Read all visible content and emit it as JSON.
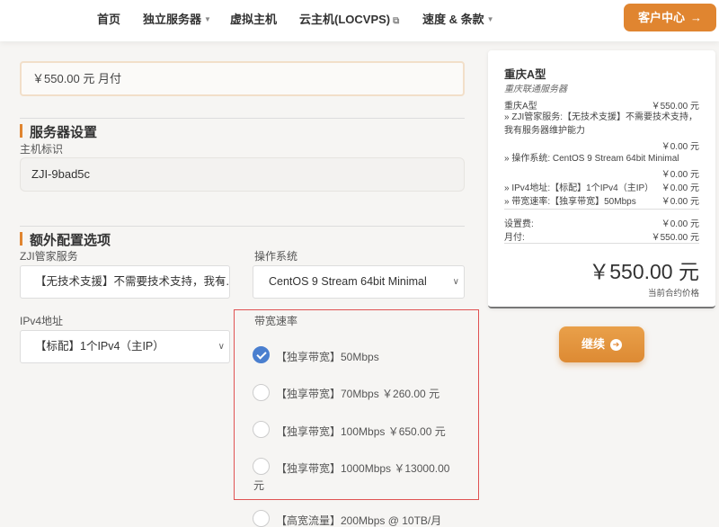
{
  "nav": {
    "items": [
      "首页",
      "独立服务器",
      "虚拟主机",
      "云主机(LOCVPS)",
      "速度 & 条款"
    ],
    "client_button": "客户中心"
  },
  "form": {
    "price_value": "￥550.00 元 月付",
    "server_settings_title": "服务器设置",
    "hostname_label": "主机标识",
    "hostname_value": "ZJI-9bad5c",
    "extra_title": "额外配置选项",
    "mgmt_label": "ZJI管家服务",
    "mgmt_value": "【无技术支援】不需要技术支持，我有...",
    "os_label": "操作系统",
    "os_value": "CentOS 9 Stream 64bit Minimal",
    "ipv4_label": "IPv4地址",
    "ipv4_value": "【标配】1个IPv4（主IP）",
    "bandwidth_label": "带宽速率",
    "bandwidth_options": [
      {
        "label": "【独享带宽】50Mbps",
        "checked": true
      },
      {
        "label": "【独享带宽】70Mbps ￥260.00 元",
        "checked": false
      },
      {
        "label": "【独享带宽】100Mbps ￥650.00 元",
        "checked": false
      },
      {
        "label_line1": "【独享带宽】1000Mbps ￥13000.00",
        "label_line2": "元",
        "checked": false
      }
    ],
    "traffic_option": "【高宽流量】200Mbps @ 10TB/月"
  },
  "summary": {
    "title": "重庆A型",
    "subtitle": "重庆联通服务器",
    "base_label": "重庆A型",
    "base_price": "￥550.00 元",
    "mgmt_text": "» ZJI管家服务:【无技术支援】不需要技术支持，我有服务器维护能力",
    "mgmt_price": "￥0.00 元",
    "os_text": "» 操作系统: CentOS 9 Stream 64bit Minimal",
    "os_price": "￥0.00 元",
    "ipv4_label": "» IPv4地址:【标配】1个IPv4（主IP）",
    "ipv4_price": "￥0.00 元",
    "bw_label": "» 带宽速率:【独享带宽】50Mbps",
    "bw_price": "￥0.00 元",
    "setup_label": "设置费:",
    "setup_price": "￥0.00 元",
    "monthly_label": "月付:",
    "monthly_price": "￥550.00 元",
    "total": "￥550.00 元",
    "total_label": "当前合约价格"
  },
  "continue_button": "继续",
  "colors": {
    "accent": "#e08530",
    "checked": "#4a7fcf",
    "highlight_border": "#e05252"
  }
}
